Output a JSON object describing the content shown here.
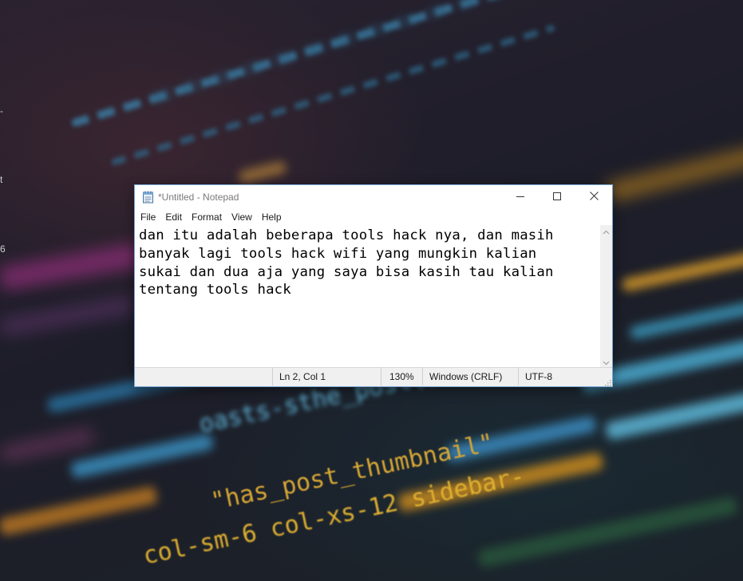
{
  "desktop": {
    "edge_glyphs": [
      "-",
      "t",
      "6"
    ],
    "wallpaper_code": [
      "oasts-sthe_post()?>",
      "\"has_post_thumbnail\"",
      "col-sm-6 col-xs-12 sidebar-"
    ]
  },
  "window": {
    "title": "*Untitled - Notepad",
    "icons": {
      "app": "notepad-icon",
      "minimize": "minimize-icon",
      "maximize": "maximize-icon",
      "close": "close-icon"
    }
  },
  "menu": {
    "items": [
      "File",
      "Edit",
      "Format",
      "View",
      "Help"
    ]
  },
  "editor": {
    "lines": [
      "dan itu adalah beberapa tools hack nya, dan masih",
      "banyak lagi tools hack wifi yang mungkin kalian",
      "sukai dan dua aja yang saya bisa kasih tau kalian",
      "tentang tools hack"
    ]
  },
  "status": {
    "position": "Ln 2, Col 1",
    "zoom": "130%",
    "line_ending": "Windows (CRLF)",
    "encoding": "UTF-8"
  },
  "colors": {
    "window_border": "#7aa7d8",
    "statusbar_bg": "#f0f0f0",
    "title_text": "#7a7a7a"
  }
}
